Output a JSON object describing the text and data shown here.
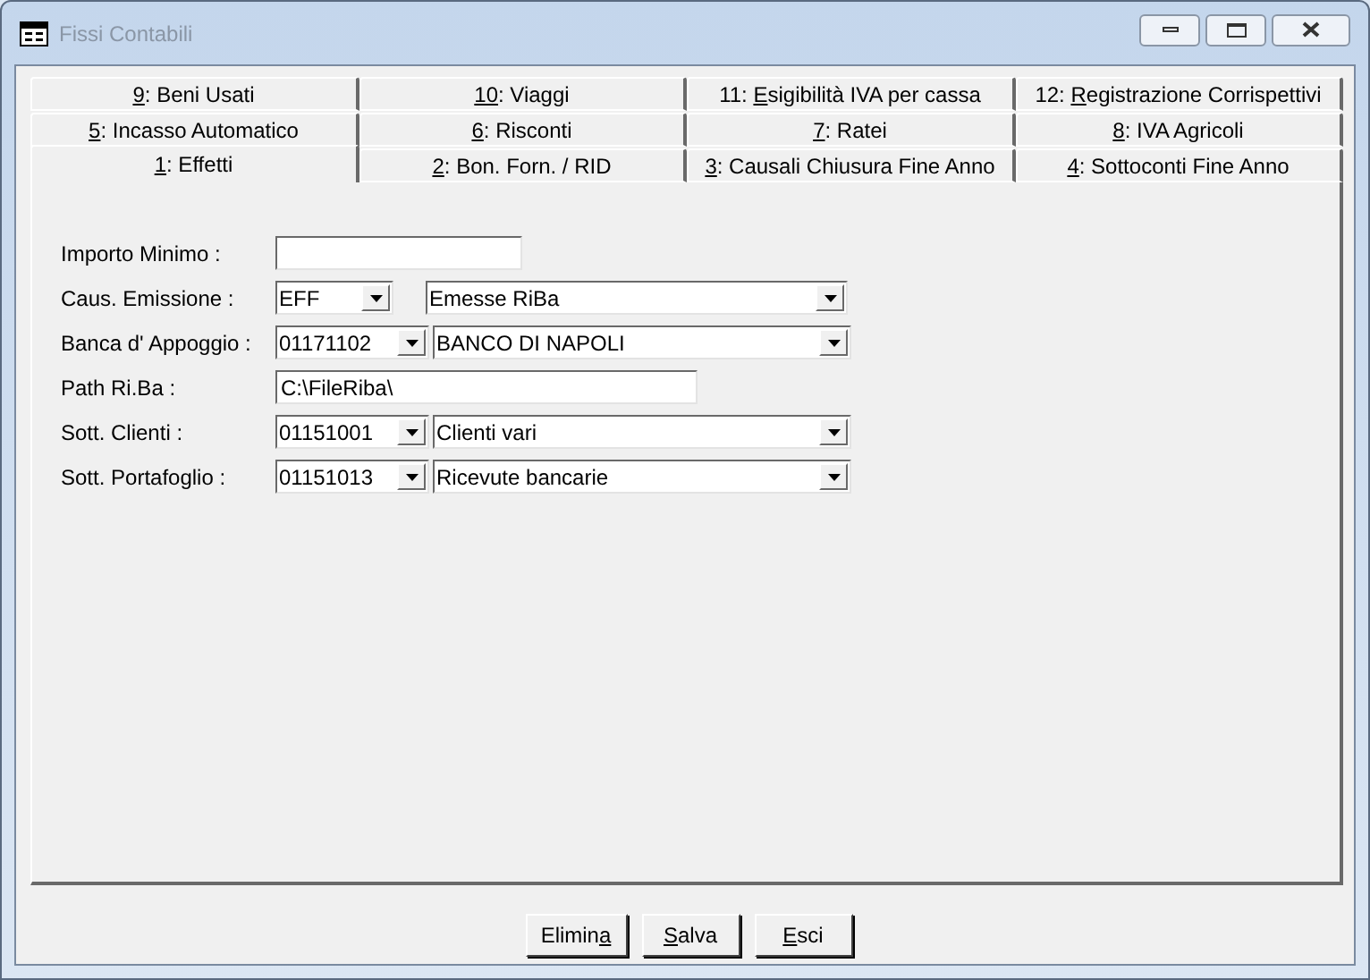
{
  "window": {
    "title": "Fissi Contabili"
  },
  "tab_rows": [
    [
      {
        "key": "9",
        "post": ": Beni Usati",
        "selected": false
      },
      {
        "key": "10",
        "post": ": Viaggi",
        "selected": false
      },
      {
        "pre": "11: ",
        "key": "E",
        "post": "sigibilità IVA per cassa",
        "selected": false
      },
      {
        "pre": "12: ",
        "key": "R",
        "post": "egistrazione Corrispettivi",
        "selected": false
      }
    ],
    [
      {
        "key": "5",
        "post": ": Incasso Automatico",
        "selected": false
      },
      {
        "key": "6",
        "post": ": Risconti",
        "selected": false
      },
      {
        "key": "7",
        "post": ": Ratei",
        "selected": false
      },
      {
        "key": "8",
        "post": ": IVA Agricoli",
        "selected": false
      }
    ],
    [
      {
        "key": "1",
        "post": ": Effetti",
        "selected": true
      },
      {
        "key": "2",
        "post": ": Bon. Forn. / RID",
        "selected": false
      },
      {
        "key": "3",
        "post": ": Causali Chiusura Fine Anno",
        "selected": false
      },
      {
        "key": "4",
        "post": ": Sottoconti Fine Anno",
        "selected": false
      }
    ]
  ],
  "fields": [
    {
      "kind": "text",
      "label": "Importo Minimo :"
    },
    {
      "kind": "combo_pair",
      "label": "Caus. Emissione :",
      "code": "EFF",
      "description": "Emesse RiBa"
    },
    {
      "kind": "combo_pair",
      "label": "Banca d' Appoggio  :",
      "code": "01171102",
      "description": "BANCO DI NAPOLI"
    },
    {
      "kind": "text",
      "label": "Path Ri.Ba :",
      "value": "C:\\FileRiba\\"
    },
    {
      "kind": "combo_pair",
      "label": "Sott. Clienti :",
      "code": "01151001",
      "description": "Clienti vari"
    },
    {
      "kind": "combo_pair",
      "label": "Sott. Portafoglio :",
      "code": "01151013",
      "description": "Ricevute bancarie"
    }
  ],
  "buttons": [
    {
      "pre": "Elimin",
      "key": "a"
    },
    {
      "key": "S",
      "post": "alva"
    },
    {
      "key": "E",
      "post": "sci"
    }
  ]
}
